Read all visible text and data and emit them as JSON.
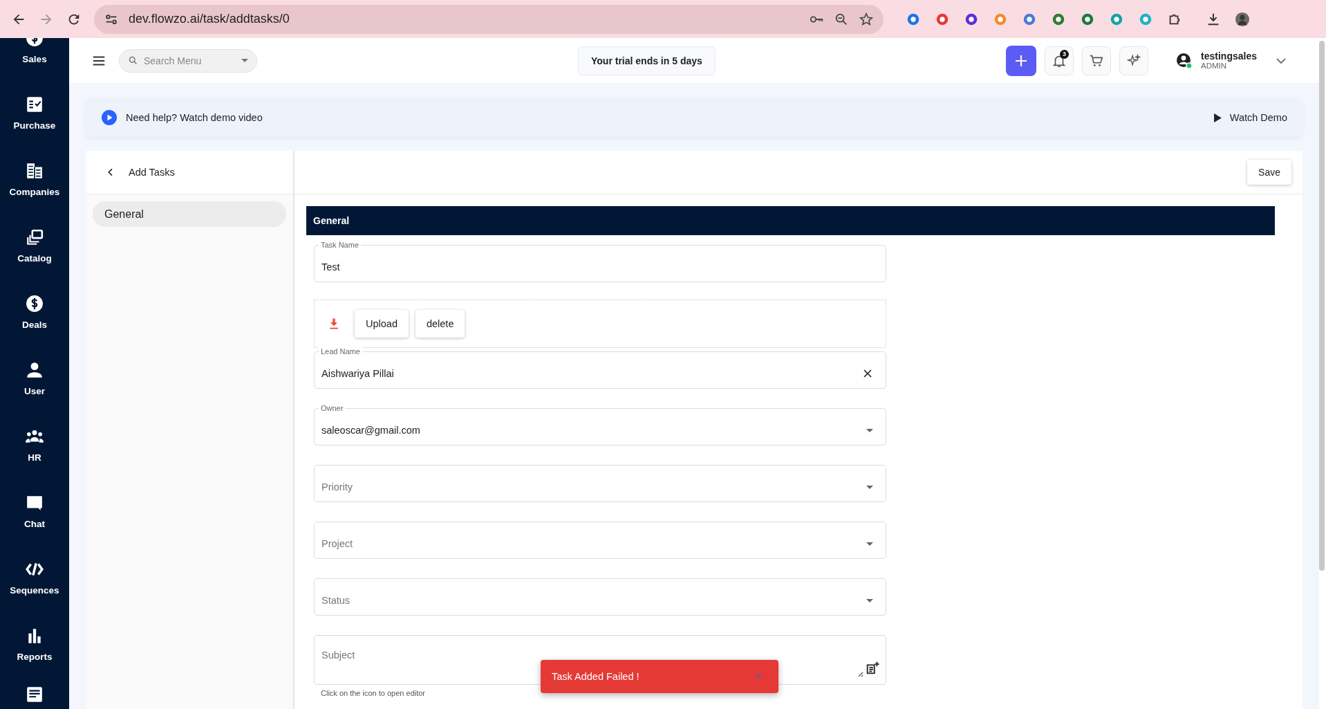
{
  "browser": {
    "url": "dev.flowzo.ai/task/addtasks/0"
  },
  "sidebar": {
    "items": [
      {
        "label": "Sales"
      },
      {
        "label": "Purchase"
      },
      {
        "label": "Companies"
      },
      {
        "label": "Catalog"
      },
      {
        "label": "Deals"
      },
      {
        "label": "User"
      },
      {
        "label": "HR"
      },
      {
        "label": "Chat"
      },
      {
        "label": "Sequences"
      },
      {
        "label": "Reports"
      }
    ]
  },
  "header": {
    "search": {
      "placeholder": "Search Menu"
    },
    "trial": "Your trial ends in 5 days",
    "notifications": "3",
    "user": {
      "name": "testingsales",
      "role": "ADMIN"
    }
  },
  "help_banner": {
    "text": "Need help? Watch demo video",
    "button": "Watch Demo"
  },
  "left_panel": {
    "title": "Add Tasks",
    "items": [
      {
        "label": "General",
        "selected": true
      }
    ]
  },
  "save_button": "Save",
  "section": {
    "title": "General"
  },
  "fields": [
    {
      "kind": "text",
      "label": "Task Name",
      "value": "Test"
    },
    {
      "kind": "upload",
      "buttons": [
        "Upload",
        "delete"
      ]
    },
    {
      "kind": "autocomplete",
      "label": "Lead Name",
      "value": "Aishwariya Pillai"
    },
    {
      "kind": "select",
      "label": "Owner",
      "value": "saleoscar@gmail.com"
    },
    {
      "kind": "select",
      "placeholder": "Priority"
    },
    {
      "kind": "select",
      "placeholder": "Project"
    },
    {
      "kind": "select",
      "placeholder": "Status"
    },
    {
      "kind": "editor",
      "placeholder": "Subject",
      "helper": "Click on the icon to open editor"
    }
  ],
  "toast": {
    "message": "Task Added Failed !",
    "close": "×"
  }
}
